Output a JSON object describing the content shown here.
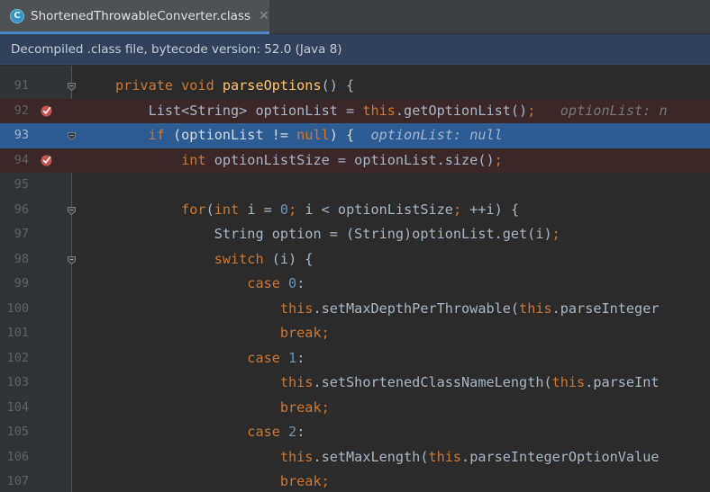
{
  "tab": {
    "icon_letter": "C",
    "filename": "ShortenedThrowableConverter.class",
    "close_glyph": "✕"
  },
  "banner": {
    "text": "Decompiled .class file, bytecode version: 52.0 (Java 8)"
  },
  "colors": {
    "background": "#2b2b2b",
    "keyword": "#cc7832",
    "method": "#ffc66d",
    "number": "#6897bb",
    "breakpoint_line": "#3b2628",
    "execution_line": "#2d5b93"
  },
  "lines": [
    {
      "num": "91",
      "state": "normal",
      "marker": "fold",
      "tokens": [
        [
          "kw",
          "private void "
        ],
        [
          "fn",
          "parseOptions"
        ],
        [
          "t",
          "() {"
        ]
      ]
    },
    {
      "num": "92",
      "state": "breakpoint",
      "marker": "breakpoint-icon",
      "tokens": [
        [
          "t",
          "    List<String> optionList = "
        ],
        [
          "kw",
          "this"
        ],
        [
          "t",
          "."
        ],
        [
          "t",
          "getOptionList()"
        ],
        [
          "kw",
          ";"
        ],
        [
          "h",
          "   optionList: n"
        ]
      ]
    },
    {
      "num": "93",
      "state": "execution",
      "marker": "fold",
      "tokens": [
        [
          "kw",
          "    if "
        ],
        [
          "t",
          "(optionList != "
        ],
        [
          "kw",
          "null"
        ],
        [
          "t",
          ") {"
        ],
        [
          "h",
          "  optionList: null"
        ]
      ]
    },
    {
      "num": "94",
      "state": "breakpoint",
      "marker": "breakpoint-icon",
      "tokens": [
        [
          "kw",
          "        int "
        ],
        [
          "t",
          "optionListSize = optionList.size()"
        ],
        [
          "kw",
          ";"
        ]
      ]
    },
    {
      "num": "95",
      "state": "normal",
      "marker": "",
      "tokens": []
    },
    {
      "num": "96",
      "state": "normal",
      "marker": "fold",
      "tokens": [
        [
          "kw",
          "        for"
        ],
        [
          "t",
          "("
        ],
        [
          "kw",
          "int "
        ],
        [
          "t",
          "i = "
        ],
        [
          "num",
          "0"
        ],
        [
          "kw",
          "; "
        ],
        [
          "t",
          "i < optionListSize"
        ],
        [
          "kw",
          "; "
        ],
        [
          "t",
          "++i) {"
        ]
      ]
    },
    {
      "num": "97",
      "state": "normal",
      "marker": "",
      "tokens": [
        [
          "t",
          "            String option = (String)optionList.get(i)"
        ],
        [
          "kw",
          ";"
        ]
      ]
    },
    {
      "num": "98",
      "state": "normal",
      "marker": "fold",
      "tokens": [
        [
          "kw",
          "            switch "
        ],
        [
          "t",
          "(i) {"
        ]
      ]
    },
    {
      "num": "99",
      "state": "normal",
      "marker": "",
      "tokens": [
        [
          "kw",
          "                case "
        ],
        [
          "num",
          "0"
        ],
        [
          "t",
          ":"
        ]
      ]
    },
    {
      "num": "100",
      "state": "normal",
      "marker": "",
      "tokens": [
        [
          "kw",
          "                    this"
        ],
        [
          "t",
          ".setMaxDepthPerThrowable("
        ],
        [
          "kw",
          "this"
        ],
        [
          "t",
          ".parseInteger"
        ]
      ]
    },
    {
      "num": "101",
      "state": "normal",
      "marker": "",
      "tokens": [
        [
          "kw",
          "                    break;"
        ]
      ]
    },
    {
      "num": "102",
      "state": "normal",
      "marker": "",
      "tokens": [
        [
          "kw",
          "                case "
        ],
        [
          "num",
          "1"
        ],
        [
          "t",
          ":"
        ]
      ]
    },
    {
      "num": "103",
      "state": "normal",
      "marker": "",
      "tokens": [
        [
          "kw",
          "                    this"
        ],
        [
          "t",
          ".setShortenedClassNameLength("
        ],
        [
          "kw",
          "this"
        ],
        [
          "t",
          ".parseInt"
        ]
      ]
    },
    {
      "num": "104",
      "state": "normal",
      "marker": "",
      "tokens": [
        [
          "kw",
          "                    break;"
        ]
      ]
    },
    {
      "num": "105",
      "state": "normal",
      "marker": "",
      "tokens": [
        [
          "kw",
          "                case "
        ],
        [
          "num",
          "2"
        ],
        [
          "t",
          ":"
        ]
      ]
    },
    {
      "num": "106",
      "state": "normal",
      "marker": "",
      "tokens": [
        [
          "kw",
          "                    this"
        ],
        [
          "t",
          ".setMaxLength("
        ],
        [
          "kw",
          "this"
        ],
        [
          "t",
          ".parseIntegerOptionValue"
        ]
      ]
    },
    {
      "num": "107",
      "state": "normal",
      "marker": "",
      "tokens": [
        [
          "kw",
          "                    break;"
        ]
      ]
    }
  ]
}
